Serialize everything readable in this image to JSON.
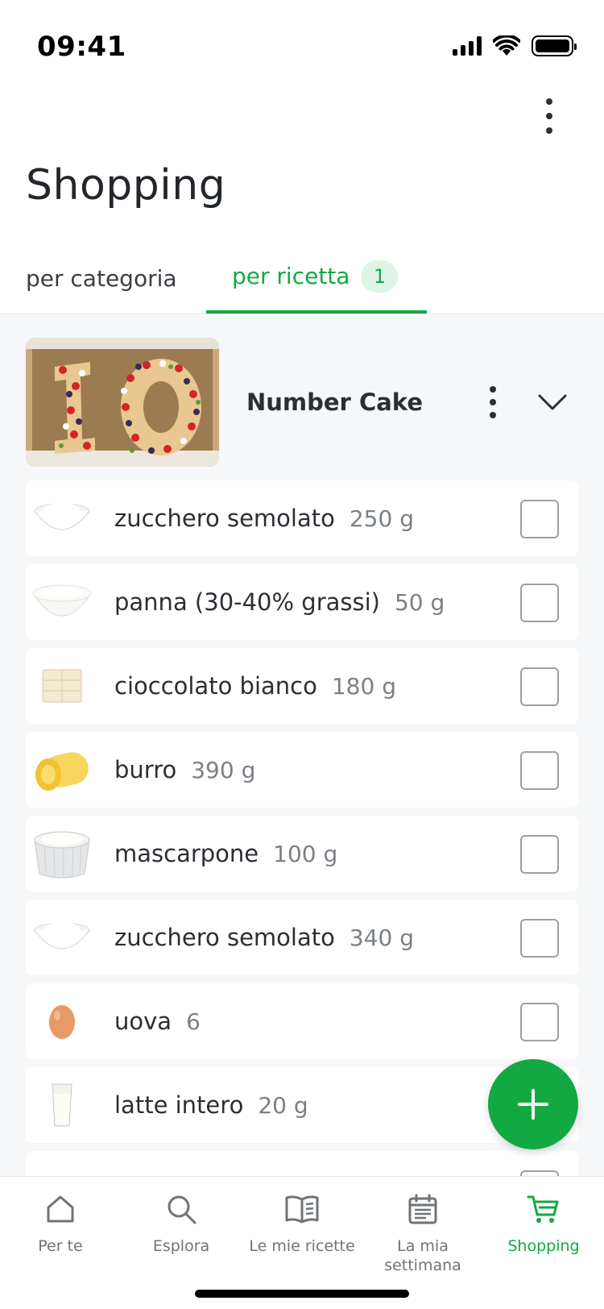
{
  "status_bar": {
    "time": "09:41"
  },
  "header": {
    "title": "Shopping",
    "more_icon": "more-vertical-icon"
  },
  "tabs": [
    {
      "label": "per categoria",
      "active": false
    },
    {
      "label": "per ricetta",
      "badge": "1",
      "active": true
    }
  ],
  "recipe": {
    "name": "Number Cake",
    "image": "number-cake-photo"
  },
  "ingredients": [
    {
      "name": "zucchero semolato",
      "qty": "250 g",
      "icon": "sugar-bowl-icon",
      "checked": false
    },
    {
      "name": "panna (30-40% grassi)",
      "qty": "50 g",
      "icon": "cream-bowl-icon",
      "checked": false
    },
    {
      "name": "cioccolato bianco",
      "qty": "180 g",
      "icon": "white-chocolate-icon",
      "checked": false
    },
    {
      "name": "burro",
      "qty": "390 g",
      "icon": "butter-icon",
      "checked": false
    },
    {
      "name": "mascarpone",
      "qty": "100 g",
      "icon": "mascarpone-icon",
      "checked": false
    },
    {
      "name": "zucchero semolato",
      "qty": "340 g",
      "icon": "sugar-bowl-icon",
      "checked": false
    },
    {
      "name": "uova",
      "qty": "6",
      "icon": "egg-icon",
      "checked": false
    },
    {
      "name": "latte intero",
      "qty": "20 g",
      "icon": "milk-glass-icon",
      "checked": false
    }
  ],
  "fab": {
    "icon": "plus-icon"
  },
  "bottom_nav": [
    {
      "label": "Per te",
      "icon": "home-icon",
      "active": false
    },
    {
      "label": "Esplora",
      "icon": "search-icon",
      "active": false
    },
    {
      "label": "Le mie ricette",
      "icon": "book-icon",
      "active": false
    },
    {
      "label": "La mia settimana",
      "icon": "calendar-icon",
      "active": false
    },
    {
      "label": "Shopping",
      "icon": "cart-icon",
      "active": true
    }
  ],
  "colors": {
    "accent": "#12a943",
    "badge_bg": "#dff3e6",
    "list_bg": "#f6f7f8"
  }
}
